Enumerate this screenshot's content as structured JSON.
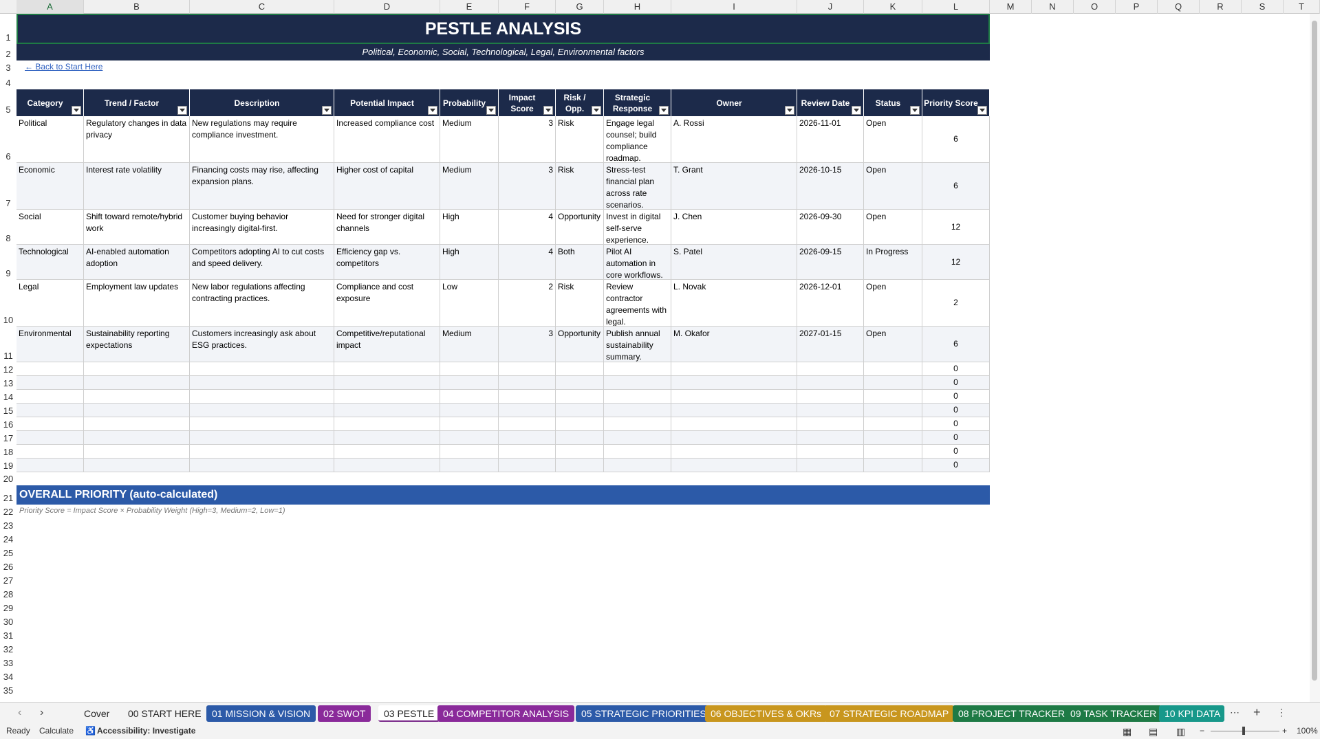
{
  "columns": [
    "A",
    "B",
    "C",
    "D",
    "E",
    "F",
    "G",
    "H",
    "I",
    "J",
    "K",
    "L",
    "M",
    "N",
    "O",
    "P",
    "Q",
    "R",
    "S",
    "T"
  ],
  "title": "PESTLE ANALYSIS",
  "subtitle": "Political, Economic, Social, Technological, Legal, Environmental factors",
  "back_link": "← Back to Start Here",
  "headers": [
    "Category",
    "Trend / Factor",
    "Description",
    "Potential Impact",
    "Probability",
    "Impact Score",
    "Risk / Opp.",
    "Strategic Response",
    "Owner",
    "Review Date",
    "Status",
    "Priority Score"
  ],
  "rows": [
    [
      "Political",
      "Regulatory changes in data privacy",
      "New regulations may require compliance investment.",
      "Increased compliance cost",
      "Medium",
      "3",
      "Risk",
      "Engage legal counsel; build compliance roadmap.",
      "A. Rossi",
      "2026-11-01",
      "Open",
      "6"
    ],
    [
      "Economic",
      "Interest rate volatility",
      "Financing costs may rise, affecting expansion plans.",
      "Higher cost of capital",
      "Medium",
      "3",
      "Risk",
      "Stress-test financial plan across rate scenarios.",
      "T. Grant",
      "2026-10-15",
      "Open",
      "6"
    ],
    [
      "Social",
      "Shift toward remote/hybrid work",
      "Customer buying behavior increasingly digital-first.",
      "Need for stronger digital channels",
      "High",
      "4",
      "Opportunity",
      "Invest in digital self-serve experience.",
      "J. Chen",
      "2026-09-30",
      "Open",
      "12"
    ],
    [
      "Technological",
      "AI-enabled automation adoption",
      "Competitors adopting AI to cut costs and speed delivery.",
      "Efficiency gap vs. competitors",
      "High",
      "4",
      "Both",
      "Pilot AI automation in core workflows.",
      "S. Patel",
      "2026-09-15",
      "In Progress",
      "12"
    ],
    [
      "Legal",
      "Employment law updates",
      "New labor regulations affecting contracting practices.",
      "Compliance and cost exposure",
      "Low",
      "2",
      "Risk",
      "Review contractor agreements with legal.",
      "L. Novak",
      "2026-12-01",
      "Open",
      "2"
    ],
    [
      "Environmental",
      "Sustainability reporting expectations",
      "Customers increasingly ask about ESG practices.",
      "Competitive/reputational impact",
      "Medium",
      "3",
      "Opportunity",
      "Publish annual sustainability summary.",
      "M. Okafor",
      "2027-01-15",
      "Open",
      "6"
    ]
  ],
  "empty_priority": [
    "0",
    "0",
    "0",
    "0",
    "0",
    "0",
    "0",
    "0"
  ],
  "row_numbers": [
    "1",
    "2",
    "3",
    "4",
    "5",
    "6",
    "7",
    "8",
    "9",
    "10",
    "11",
    "12",
    "13",
    "14",
    "15",
    "16",
    "17",
    "18",
    "19",
    "20",
    "21",
    "22",
    "23",
    "24",
    "25",
    "26",
    "27",
    "28",
    "29",
    "30",
    "31",
    "32",
    "33",
    "34",
    "35"
  ],
  "overall_title": "OVERALL PRIORITY (auto-calculated)",
  "formula_note": "Priority Score = Impact Score × Probability Weight (High=3, Medium=2, Low=1)",
  "tabs": [
    {
      "label": "Cover",
      "color": ""
    },
    {
      "label": "00 START HERE",
      "color": ""
    },
    {
      "label": "01 MISSION & VISION",
      "color": "#2c5aa8"
    },
    {
      "label": "02 SWOT",
      "color": "#8a2a9a"
    },
    {
      "label": "03 PESTLE",
      "color": "active"
    },
    {
      "label": "04 COMPETITOR ANALYSIS",
      "color": "#8a2a9a"
    },
    {
      "label": "05 STRATEGIC PRIORITIES",
      "color": "#2c5aa8"
    },
    {
      "label": "06 OBJECTIVES & OKRs",
      "color": "#c8961e"
    },
    {
      "label": "07 STRATEGIC ROADMAP",
      "color": "#c8961e"
    },
    {
      "label": "08 PROJECT TRACKER",
      "color": "#1e7a45"
    },
    {
      "label": "09 TASK TRACKER",
      "color": "#1e7a45"
    },
    {
      "label": "10 KPI DATA",
      "color": "#17988a"
    }
  ],
  "status": {
    "ready": "Ready",
    "calculate": "Calculate",
    "accessibility": "Accessibility: Investigate",
    "zoom": "100%"
  }
}
